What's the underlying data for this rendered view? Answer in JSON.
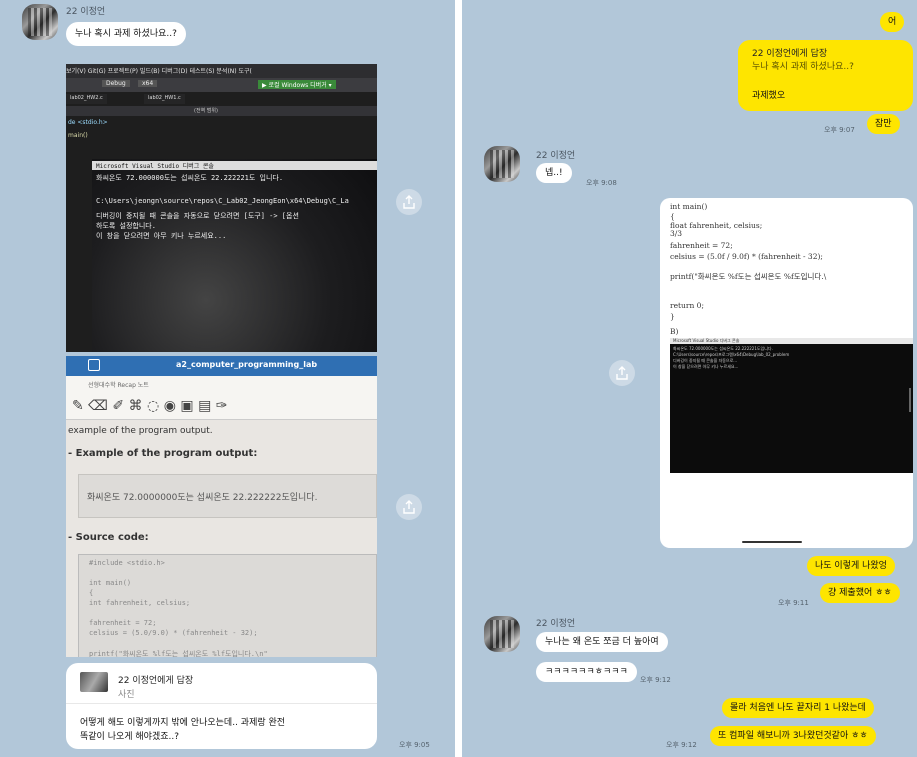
{
  "left": {
    "sender_name": "22 이정언",
    "msg1": "누나 혹시 과제 하셨나요..?",
    "photo1": {
      "menu": "보기(V)   Git(G)   프로젝트(P)   빌드(B)   디버그(D)   테스트(S)   분석(N)   도구(",
      "debug_label": "Debug",
      "arch_label": "x64",
      "run_label": "▶ 로컬 Windows 디버거 ▾",
      "tab1": "lab02_HW2.c",
      "tab2": "lab02_HW1.c",
      "scope": "(전역 범위)",
      "include": "de <stdio.h>",
      "main": "main()",
      "console_title": "Microsoft Visual Studio 디버그 콘솔",
      "out1": "화씨온도 72.000000도는 섭씨온도 22.222221도 입니다.",
      "out2": "C:\\Users\\jeongn\\source\\repos\\C_Lab02_JeongEon\\x64\\Debug\\C_La",
      "out3": "디버깅이 중지될 때 콘솔을 자동으로 닫으려면 [도구] -> [옵션",
      "out4": "하도록 설정합니다.",
      "out5": "이 창을 닫으려면 아무 키나 누르세요..."
    },
    "photo2": {
      "title": "a2_computer_programming_lab",
      "tab": "선형대수학 Recap 노트",
      "line1": "example of the program output.",
      "heading1": "- Example of the program output:",
      "output": "화씨온도 72.0000000도는 섭씨온도 22.222222도입니다.",
      "heading2": "- Source code:",
      "code": [
        "#include <stdio.h>",
        "",
        "int main()",
        "{",
        "  int fahrenheit, celsius;",
        "",
        "  fahrenheit = 72;",
        "  celsius = (5.0/9.0) * (fahrenheit - 32);",
        "",
        "  printf(\"화씨온도 %lf도는 섭씨온도 %lf도입니다.\\n\""
      ]
    },
    "reply": {
      "to": "22 이정언에게 답장",
      "sub": "사진",
      "text_line1": "어떻게 해도 이렇게까지 밖에 안나오는데.. 과제랑 완전",
      "text_line2": "똑같이 나오게 해야겠죠..?",
      "time": "오후 9:05"
    }
  },
  "right": {
    "msg_top": "어",
    "reply_box": {
      "to": "22 이정언에게 답장",
      "quote": "누나 혹시 과제 하셨나요..?",
      "text": "과제했오"
    },
    "time1": "오후 9:07",
    "msg_wait": "잠만",
    "sender_name": "22 이정언",
    "msg_ok": "넵..!",
    "time2": "오후 9:08",
    "phone": {
      "lines": [
        "int main()",
        "{",
        "        float fahrenheit, celsius;",
        "  3/3",
        "        fahrenheit = 72;",
        "        celsius = (5.0f / 9.0f) * (fahrenheit - 32);",
        "",
        "        printf(\"화씨온도 %f도는 섭씨온도 %f도입니다.\\",
        "",
        "",
        "        return 0;",
        "}"
      ],
      "label_b": "B)",
      "term_title": "Microsoft Visual Studio 디버그 콘솔",
      "term_lines": [
        "화씨온도 72.000000도는 섭씨온도 22.222221도입니다.",
        "C:\\Users\\source\\repos\\프로그램\\x64\\Debug\\lab_02_problem",
        "디버깅이 중지될 때 콘솔을 자동으로...",
        "이 창을 닫으려면 아무 키나 누르세요..."
      ]
    },
    "msg_me1": "나도 이렇게 나왔엉",
    "time3": "오후 9:11",
    "msg_me2": "걍 제출했어 ㅎㅎ",
    "sender_name2": "22 이정언",
    "msg_q": "누나는 왜 온도 쪼금 더 높아여",
    "msg_laugh": "ㅋㅋㅋㅋㅋㅋㅎㅋㅋㅋ",
    "time4": "오후 9:12",
    "msg_me3": "몰라 처음엔 나도 끝자리 1 나왔는데",
    "time5": "오후 9:12",
    "msg_me4": "또 컴파일 해보니까 3나왔던것같아 ㅎㅎ"
  },
  "colors": {
    "background": "#b2c7d9",
    "my_bubble": "#fee500",
    "other_bubble": "#ffffff"
  },
  "icons": [
    "share-icon",
    "avatar"
  ]
}
